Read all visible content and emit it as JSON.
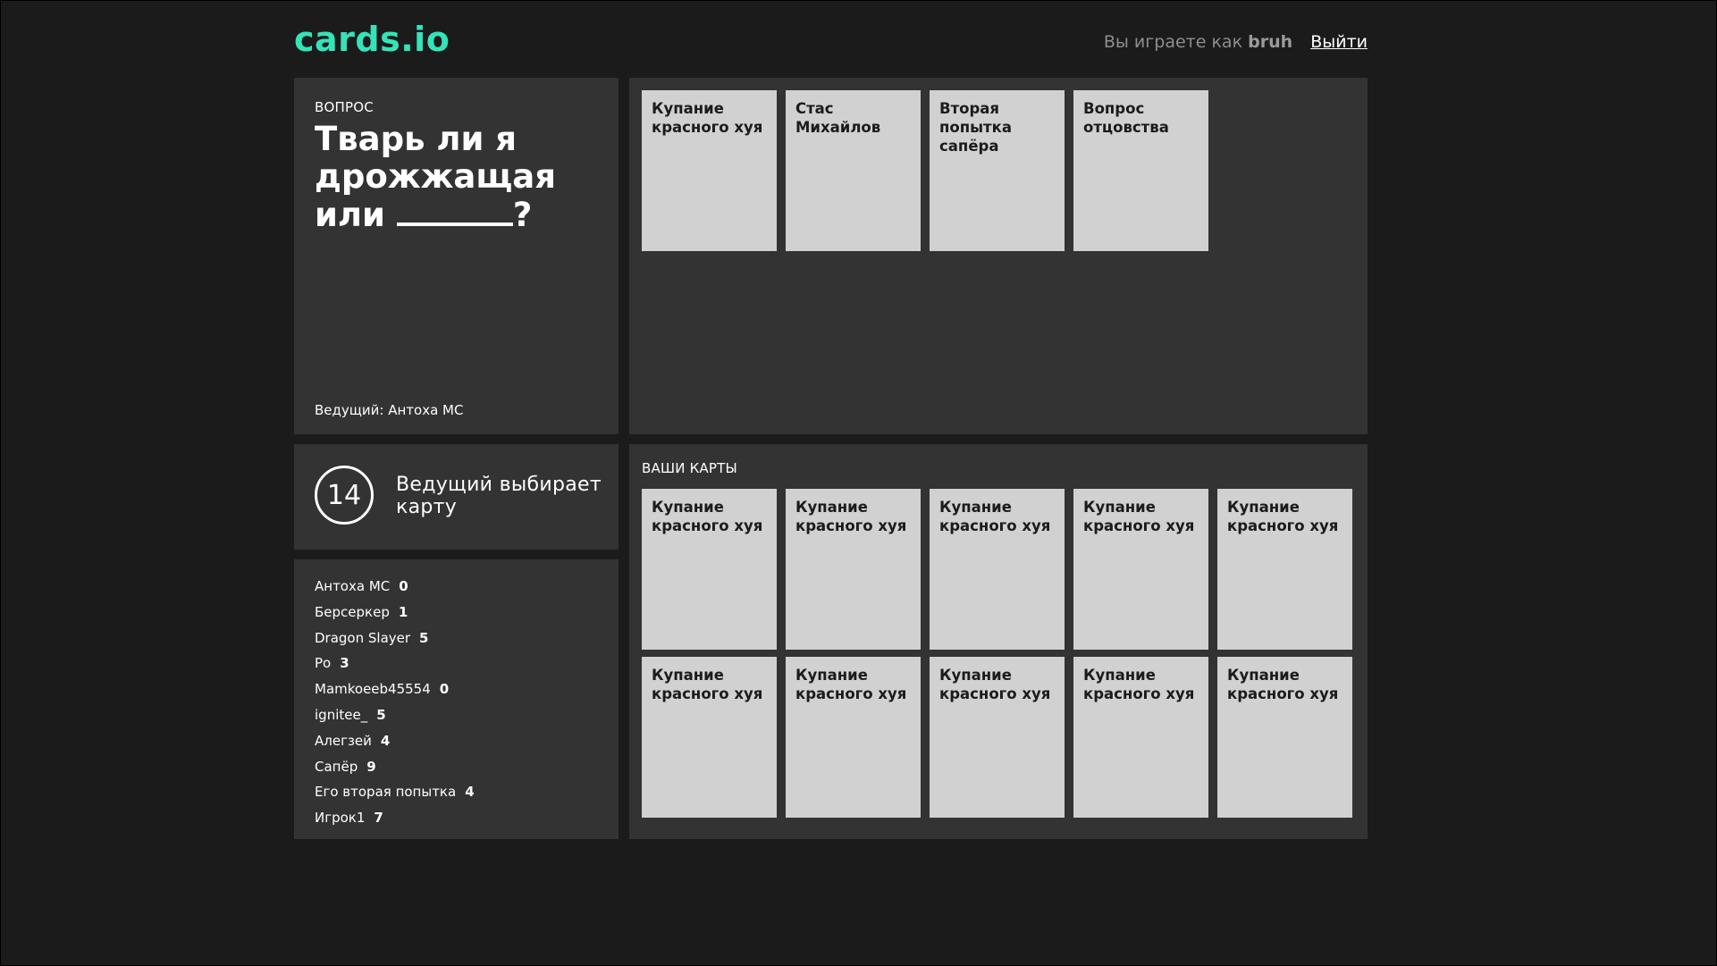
{
  "app": {
    "logo": "cards.io"
  },
  "header": {
    "playing_as_prefix": "Вы играете как",
    "username": "bruh",
    "logout_label": "Выйти"
  },
  "question": {
    "label": "ВОПРОС",
    "text_before_blank": "Тварь ли я дрожжащая или ",
    "text_after_blank": "?",
    "host_label": "Ведущий: Антоха МС"
  },
  "played_cards": [
    {
      "text": "Купание красного хуя"
    },
    {
      "text": "Стас Михайлов"
    },
    {
      "text": "Вторая попытка сапёра"
    },
    {
      "text": "Вопрос отцовства"
    }
  ],
  "status": {
    "timer": "14",
    "text": "Ведущий выбирает карту"
  },
  "players": [
    {
      "name": "Антоха МС",
      "score": "0"
    },
    {
      "name": "Берсеркер",
      "score": "1"
    },
    {
      "name": "Dragon Slayer",
      "score": "5"
    },
    {
      "name": "Ро",
      "score": "3"
    },
    {
      "name": "Mamkoeeb45554",
      "score": "0"
    },
    {
      "name": "ignitee_",
      "score": "5"
    },
    {
      "name": "Алегзей",
      "score": "4"
    },
    {
      "name": "Сапёр",
      "score": "9"
    },
    {
      "name": "Его вторая попытка",
      "score": "4"
    },
    {
      "name": "Игрок1",
      "score": "7"
    }
  ],
  "hand": {
    "label": "ВАШИ КАРТЫ",
    "cards": [
      {
        "text": "Купание красного хуя"
      },
      {
        "text": "Купание красного хуя"
      },
      {
        "text": "Купание красного хуя"
      },
      {
        "text": "Купание красного хуя"
      },
      {
        "text": "Купание красного хуя"
      },
      {
        "text": "Купание красного хуя"
      },
      {
        "text": "Купание красного хуя"
      },
      {
        "text": "Купание красного хуя"
      },
      {
        "text": "Купание красного хуя"
      },
      {
        "text": "Купание красного хуя"
      }
    ]
  },
  "colors": {
    "background": "#1b1b1b",
    "panel": "#333333",
    "card": "#d1d1d1",
    "accent": "#35e3b8"
  }
}
